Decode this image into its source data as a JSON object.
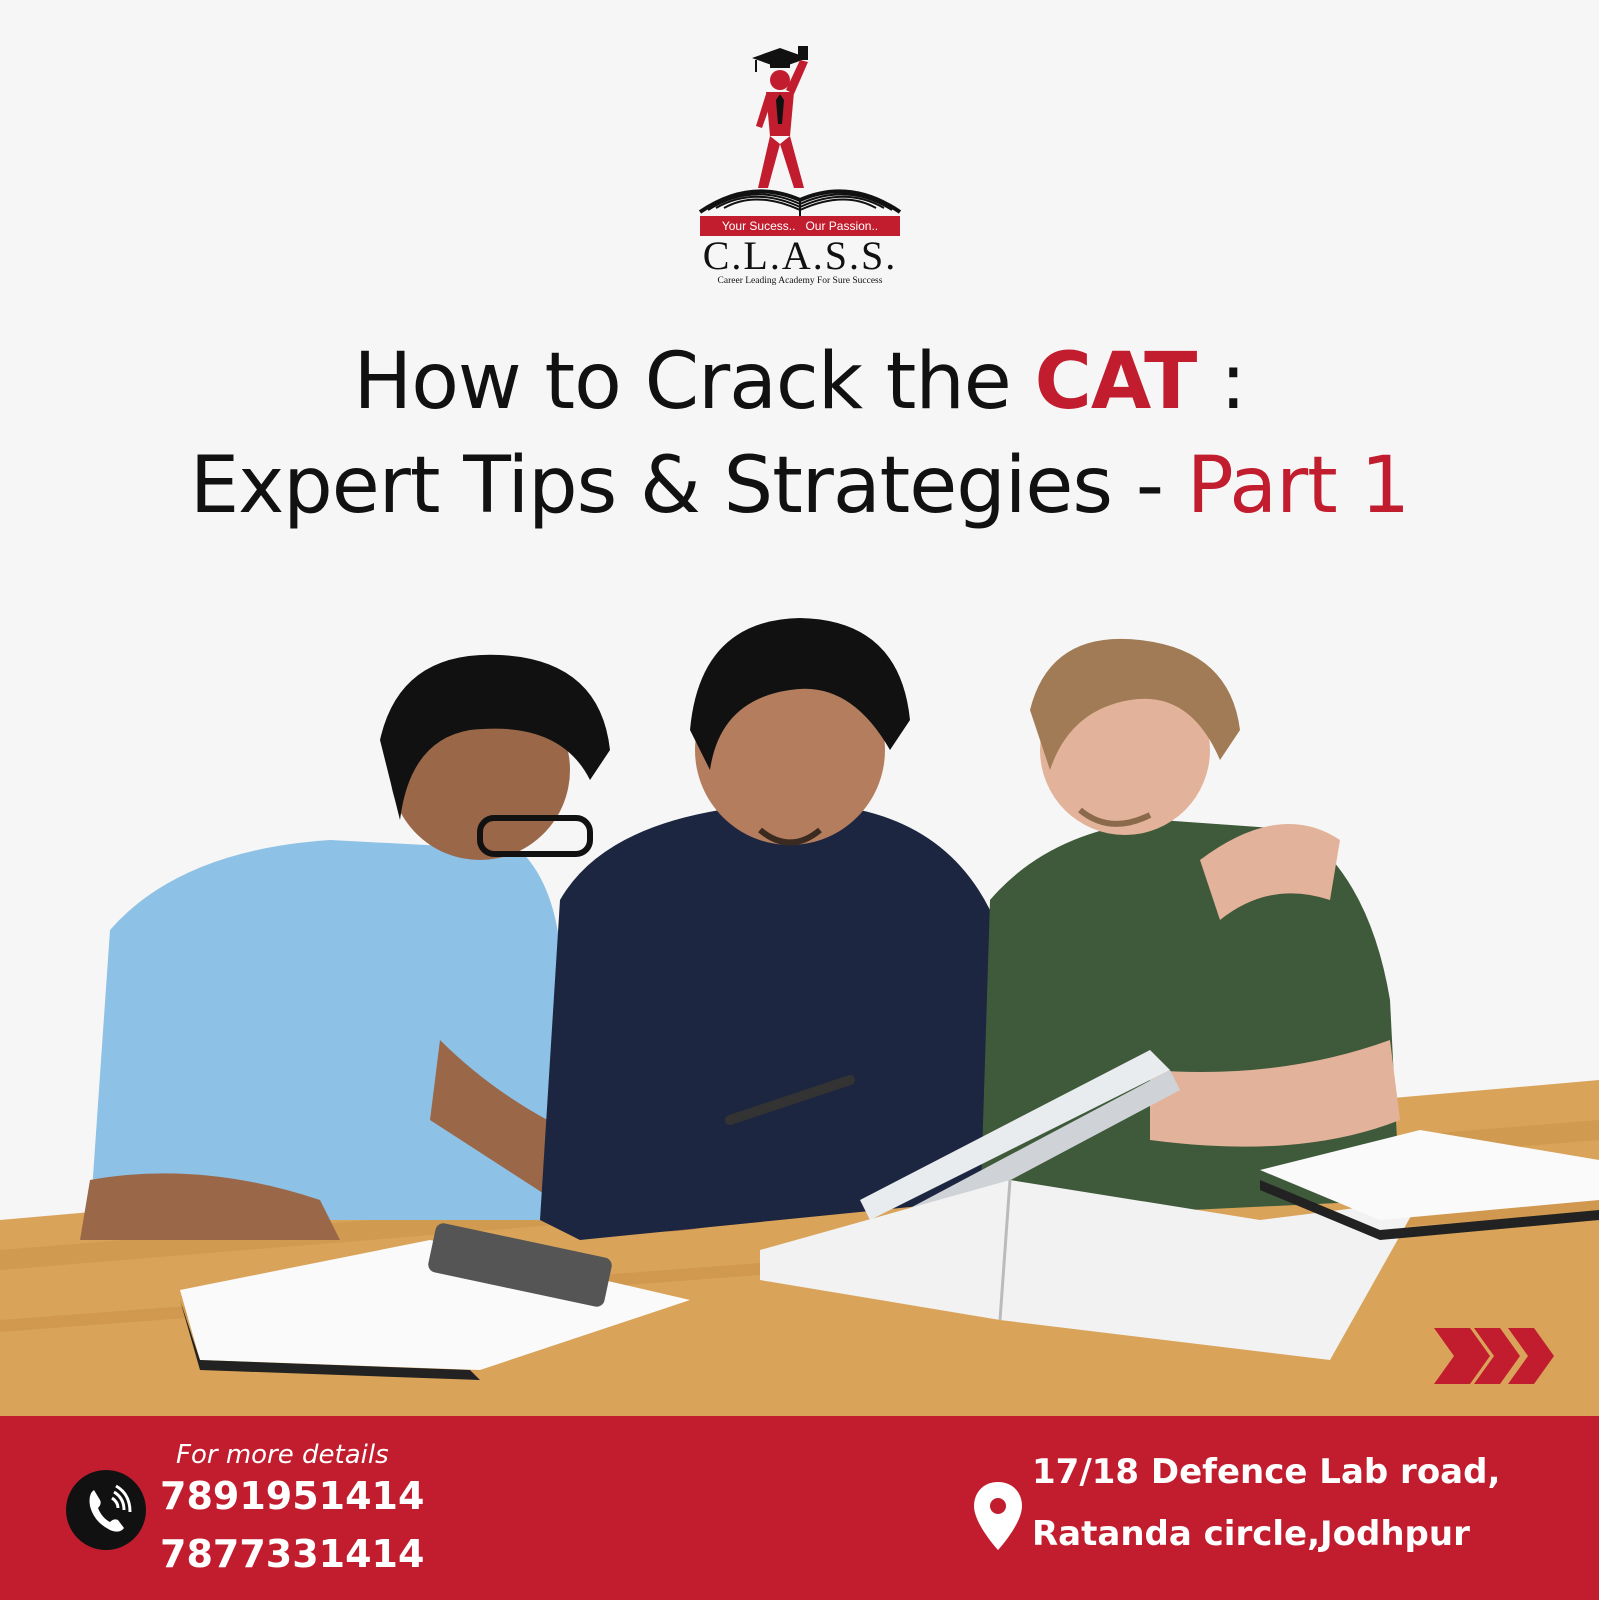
{
  "logo": {
    "tagline": "Your Sucess..   Our Passion..",
    "brand": "C.L.A.S.S.",
    "subtitle": "Career Leading Academy For Sure Success"
  },
  "headline": {
    "line1_prefix": "How to Crack the ",
    "line1_highlight": "CAT",
    "line1_suffix": " :",
    "line2_prefix": "Expert Tips & Strategies - ",
    "line2_highlight": "Part 1"
  },
  "contact": {
    "label": "For more details",
    "phones": [
      "7891951414",
      "7877331414"
    ]
  },
  "address": {
    "line1": "17/18 Defence Lab road,",
    "line2": "Ratanda circle,Jodhpur"
  },
  "icons": {
    "phone": "phone-icon",
    "location": "location-pin-icon",
    "next": "chevron-right-icon"
  },
  "colors": {
    "accent": "#c21d2e",
    "text": "#111111",
    "background": "#f6f6f6"
  }
}
